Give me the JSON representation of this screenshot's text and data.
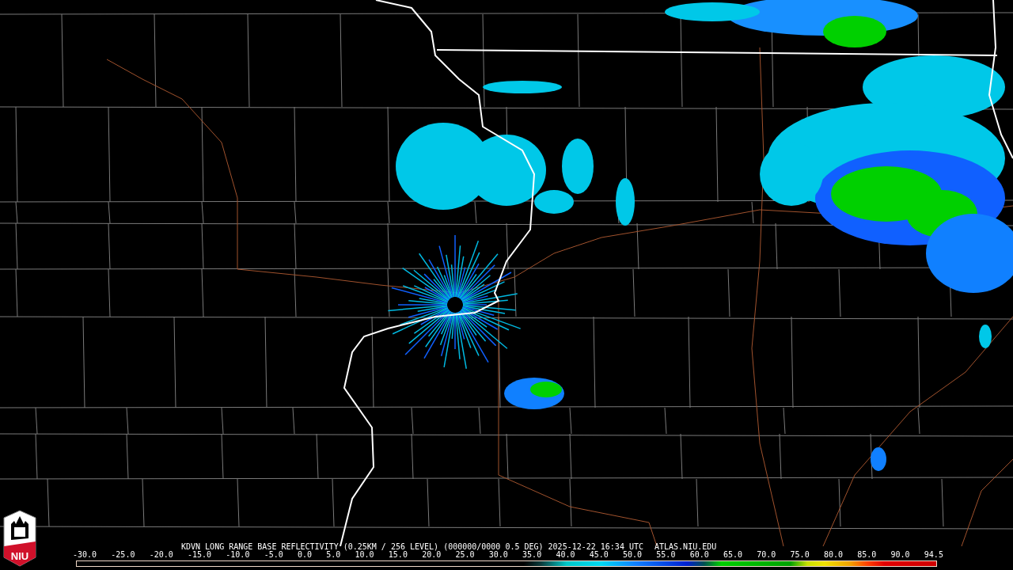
{
  "logo": {
    "text": "NIU"
  },
  "caption": {
    "title": "KDVN LONG RANGE BASE REFLECTIVITY (0.25KM / 256 LEVEL) (000000/0000 0.5 DEG) 2025-12-22 16:34 UTC",
    "source": "ATLAS.NIU.EDU"
  },
  "legend": {
    "ticks": [
      "-30.0",
      "-25.0",
      "-20.0",
      "-15.0",
      "-10.0",
      "-5.0",
      "0.0",
      "5.0",
      "10.0",
      "15.0",
      "20.0",
      "25.0",
      "30.0",
      "35.0",
      "40.0",
      "45.0",
      "50.0",
      "55.0",
      "60.0",
      "65.0",
      "70.0",
      "75.0",
      "80.0",
      "85.0",
      "90.0",
      "94.5"
    ]
  }
}
